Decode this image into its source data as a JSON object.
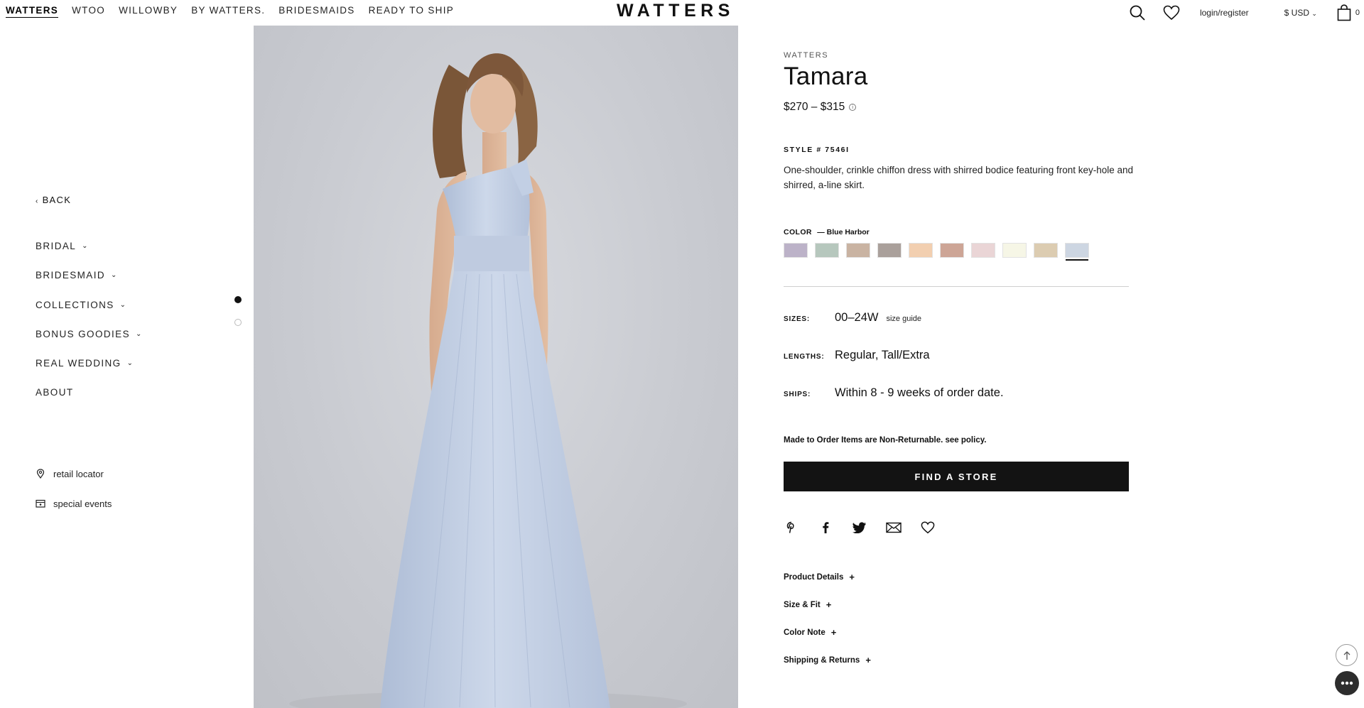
{
  "nav": {
    "links": [
      "WATTERS",
      "WTOO",
      "WILLOWBY",
      "BY WATTERS.",
      "BRIDESMAIDS",
      "READY TO SHIP"
    ],
    "logo": "WATTERS",
    "login_label": "login/register",
    "currency_label": "$ USD",
    "cart_count": "0"
  },
  "sidebar": {
    "back_label": "BACK",
    "menu": [
      "BRIDAL",
      "BRIDESMAID",
      "COLLECTIONS",
      "BONUS GOODIES",
      "REAL WEDDING",
      "ABOUT"
    ],
    "links": [
      {
        "label": "retail locator",
        "icon": "map-pin-icon"
      },
      {
        "label": "special events",
        "icon": "calendar-icon"
      }
    ]
  },
  "gallery": {
    "dots": 2,
    "active_dot": 0
  },
  "product": {
    "brand": "WATTERS",
    "title": "Tamara",
    "price": "$270 – $315",
    "style_number": "STYLE # 7546I",
    "description": "One-shoulder, crinkle chiffon dress with shirred bodice featuring front key-hole and shirred, a-line skirt.",
    "color_label": "COLOR",
    "color_selected": "— Blue Harbor",
    "swatches": [
      "#bcb2c8",
      "#b6c7bd",
      "#c9b3a2",
      "#aaa09b",
      "#f2cfb0",
      "#cda596",
      "#ead5d6",
      "#f6f6e6",
      "#dcccb1",
      "#cdd6e2"
    ],
    "selected_swatch": 9,
    "sizes_label": "SIZES:",
    "sizes_value": "00–24W",
    "size_guide": "size guide",
    "lengths_label": "LENGTHS:",
    "lengths_value": "Regular, Tall/Extra",
    "ships_label": "SHIPS:",
    "ships_value": "Within 8 - 9 weeks of order date.",
    "nonreturnable": "Made to Order Items are Non-Returnable.",
    "policy_link": "see policy.",
    "find_store": "FIND A STORE",
    "share_icons": [
      "pinterest-icon",
      "facebook-icon",
      "twitter-icon",
      "email-icon",
      "wishlist-heart-icon"
    ],
    "accordion": [
      "Product Details",
      "Size & Fit",
      "Color Note",
      "Shipping & Returns"
    ]
  }
}
